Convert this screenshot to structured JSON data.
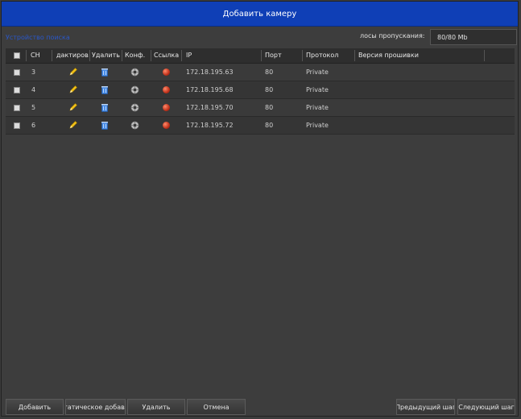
{
  "window": {
    "title": "Добавить камеру"
  },
  "info": {
    "left_text": "Устройство поиска",
    "bandwidth_label": "лосы пропускания:",
    "bandwidth_value": "80/80 Mb"
  },
  "table": {
    "headers": {
      "ch": "CH",
      "edit": "дактирова",
      "delete": "Удалить",
      "config": "Конф.",
      "link": "Ссылка",
      "ip": "IP",
      "port": "Порт",
      "protocol": "Протокол",
      "firmware": "Версия прошивки"
    },
    "rows": [
      {
        "ch": "3",
        "ip": "172.18.195.63",
        "port": "80",
        "protocol": "Private",
        "firmware": ""
      },
      {
        "ch": "4",
        "ip": "172.18.195.68",
        "port": "80",
        "protocol": "Private",
        "firmware": ""
      },
      {
        "ch": "5",
        "ip": "172.18.195.70",
        "port": "80",
        "protocol": "Private",
        "firmware": ""
      },
      {
        "ch": "6",
        "ip": "172.18.195.72",
        "port": "80",
        "protocol": "Private",
        "firmware": ""
      }
    ]
  },
  "buttons": {
    "add": "Добавить",
    "auto_add": "гатическое добав.",
    "delete": "Удалить",
    "cancel": "Отмена",
    "prev": "Предыдущий шаг",
    "next": "Следующий шаг"
  },
  "icons": {
    "edit": "pencil-icon",
    "delete": "trash-icon",
    "config": "gear-icon",
    "link": "status-dot-icon"
  },
  "colors": {
    "titlebar": "#0f3fb6",
    "background": "#3d3d3d",
    "link_status": "#c0301a"
  }
}
